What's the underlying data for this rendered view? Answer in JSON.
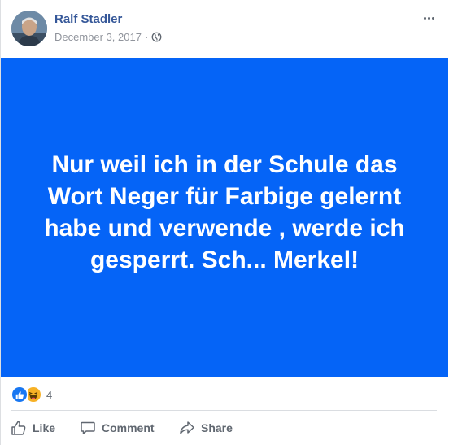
{
  "post": {
    "author": "Ralf Stadler",
    "date": "December 3, 2017",
    "separator": "·",
    "privacy_icon": "globe-icon",
    "options_icon": "more-options-icon",
    "body_text": "Nur weil ich in der Schule das Wort Neger für Farbige gelernt habe und verwende , werde ich gesperrt. Sch... Merkel!",
    "background_color": "#0564f7"
  },
  "reactions": {
    "types": [
      "like-reaction-icon",
      "haha-reaction-icon"
    ],
    "count": "4"
  },
  "actions": {
    "like": "Like",
    "comment": "Comment",
    "share": "Share"
  },
  "colors": {
    "author_link": "#365899",
    "meta_text": "#90949c",
    "action_text": "#606770",
    "like_blue": "#1877f2",
    "haha_yellow": "#f7b125"
  }
}
